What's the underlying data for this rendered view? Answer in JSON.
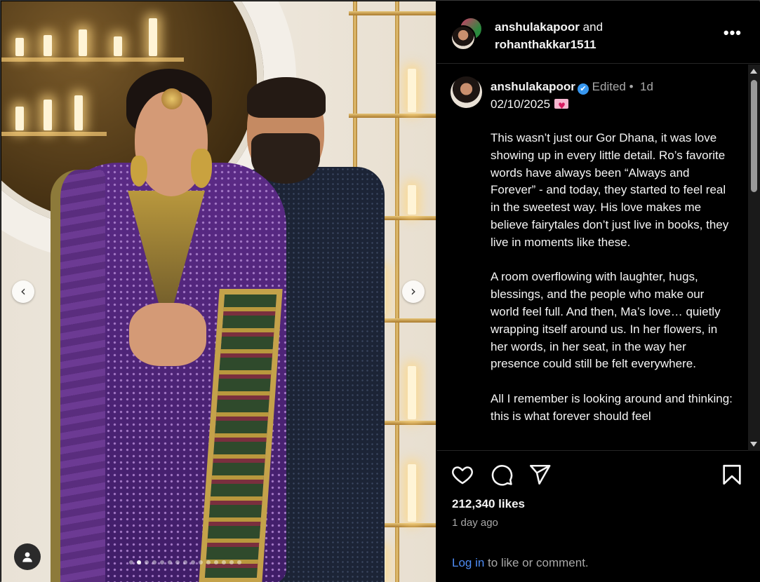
{
  "post": {
    "header": {
      "user1": "anshulakapoor",
      "joiner": "and",
      "user2": "rohanthakkar1511",
      "more_label": "•••"
    },
    "caption": {
      "username": "anshulakapoor",
      "verified_mark": "✔",
      "edited": "Edited",
      "separator": "•",
      "age": "1d",
      "date_line": "02/10/2025",
      "paragraphs": [
        "This wasn’t just our Gor Dhana, it was love showing up in every little detail. Ro’s favorite words have always been “Always and Forever” - and today, they started to feel real in the sweetest way. His love makes me believe fairytales don’t just live in books, they live in moments like these.",
        "A room overflowing with laughter, hugs, blessings, and the people who make our world feel full. And then, Ma’s love… quietly wrapping itself around us. In her flowers, in her words, in her seat, in the way her presence could still be felt everywhere.",
        "All I remember is looking around and thinking: this is what forever should feel"
      ]
    },
    "likes": "212,340 likes",
    "time_ago": "1 day ago",
    "login": {
      "link": "Log in",
      "rest": " to like or comment."
    }
  },
  "carousel": {
    "prev_glyph": "‹",
    "next_glyph": "›",
    "slide_count": 15,
    "active_index": 1
  },
  "colors": {
    "background": "#000000",
    "text": "#f5f5f5",
    "muted": "#a8a8a8",
    "link": "#4f8df5",
    "verified": "#3797f0"
  },
  "icons": [
    "heart-icon",
    "comment-icon",
    "share-icon",
    "bookmark-icon",
    "user-tag-icon",
    "chevron-left-icon",
    "chevron-right-icon",
    "more-icon",
    "verified-icon"
  ]
}
